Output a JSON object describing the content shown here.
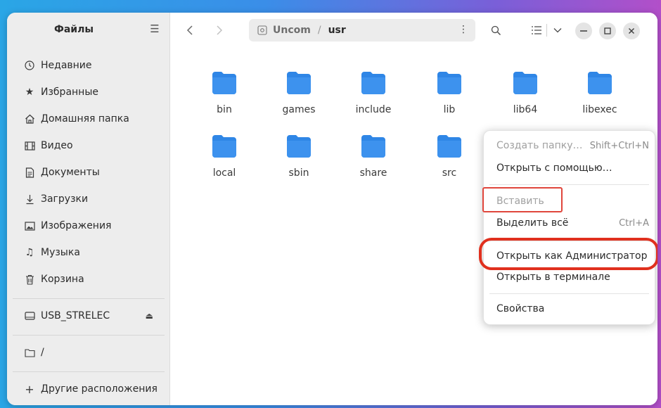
{
  "sidebar": {
    "title": "Файлы",
    "items": [
      {
        "label": "Недавние",
        "icon": "clock-icon"
      },
      {
        "label": "Избранные",
        "icon": "star-icon"
      },
      {
        "label": "Домашняя папка",
        "icon": "home-icon"
      },
      {
        "label": "Видео",
        "icon": "film-icon"
      },
      {
        "label": "Документы",
        "icon": "document-icon"
      },
      {
        "label": "Загрузки",
        "icon": "download-icon"
      },
      {
        "label": "Изображения",
        "icon": "image-icon"
      },
      {
        "label": "Музыка",
        "icon": "music-icon"
      },
      {
        "label": "Корзина",
        "icon": "trash-icon"
      }
    ],
    "drive": "USB_STRELEC",
    "root": "/",
    "other": "Другие расположения"
  },
  "path": {
    "parent": "Uncom",
    "sep": "/",
    "current": "usr"
  },
  "folders": [
    "bin",
    "games",
    "include",
    "lib",
    "lib64",
    "libexec",
    "local",
    "sbin",
    "share",
    "src"
  ],
  "context_menu": {
    "create_folder": "Создать папку…",
    "create_folder_shortcut": "Shift+Ctrl+N",
    "open_with": "Открыть с помощью…",
    "paste": "Вставить",
    "select_all": "Выделить всё",
    "select_all_shortcut": "Ctrl+A",
    "open_as_admin": "Открыть как Администратор",
    "open_terminal": "Открыть в терминале",
    "properties": "Свойства"
  },
  "colors": {
    "folder": "#2f86e6",
    "highlight": "#e0301e"
  }
}
